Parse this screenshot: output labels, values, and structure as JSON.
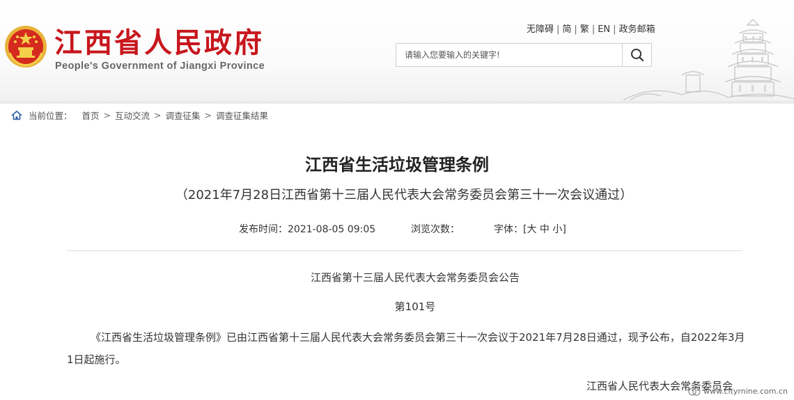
{
  "header": {
    "title_cn": "江西省人民政府",
    "title_en": "People's Government of Jiangxi Province",
    "toplinks": [
      "无障碍",
      "简",
      "繁",
      "EN",
      "政务邮箱"
    ],
    "search": {
      "placeholder": "请输入您要输入的关键字!",
      "icon": "search-icon"
    }
  },
  "breadcrumb": {
    "icon": "home-icon",
    "label": "当前位置：",
    "items": [
      "首页",
      "互动交流",
      "调查征集",
      "调查征集结果"
    ]
  },
  "article": {
    "title": "江西省生活垃圾管理条例",
    "subtitle": "（2021年7月28日江西省第十三届人民代表大会常务委员会第三十一次会议通过）",
    "meta": {
      "publish_time": "发布时间：2021-08-05 09:05",
      "views": "浏览次数：",
      "font_size_label": "字体：",
      "font_size_open": "[",
      "font_sizes": [
        "大",
        "中",
        "小"
      ],
      "font_size_close": "]"
    },
    "notice_title": "江西省第十三届人民代表大会常务委员会公告",
    "notice_number": "第101号",
    "paragraph": "《江西省生活垃圾管理条例》已由江西省第十三届人民代表大会常务委员会第三十一次会议于2021年7月28日通过，现予公布，自2022年3月1日起施行。",
    "signature": "江西省人民代表大会常务委员会"
  },
  "watermark": "www.cityrnine.com.cn",
  "colors": {
    "brand_red": "#c8161d",
    "emblem_gold": "#e8b33a"
  }
}
